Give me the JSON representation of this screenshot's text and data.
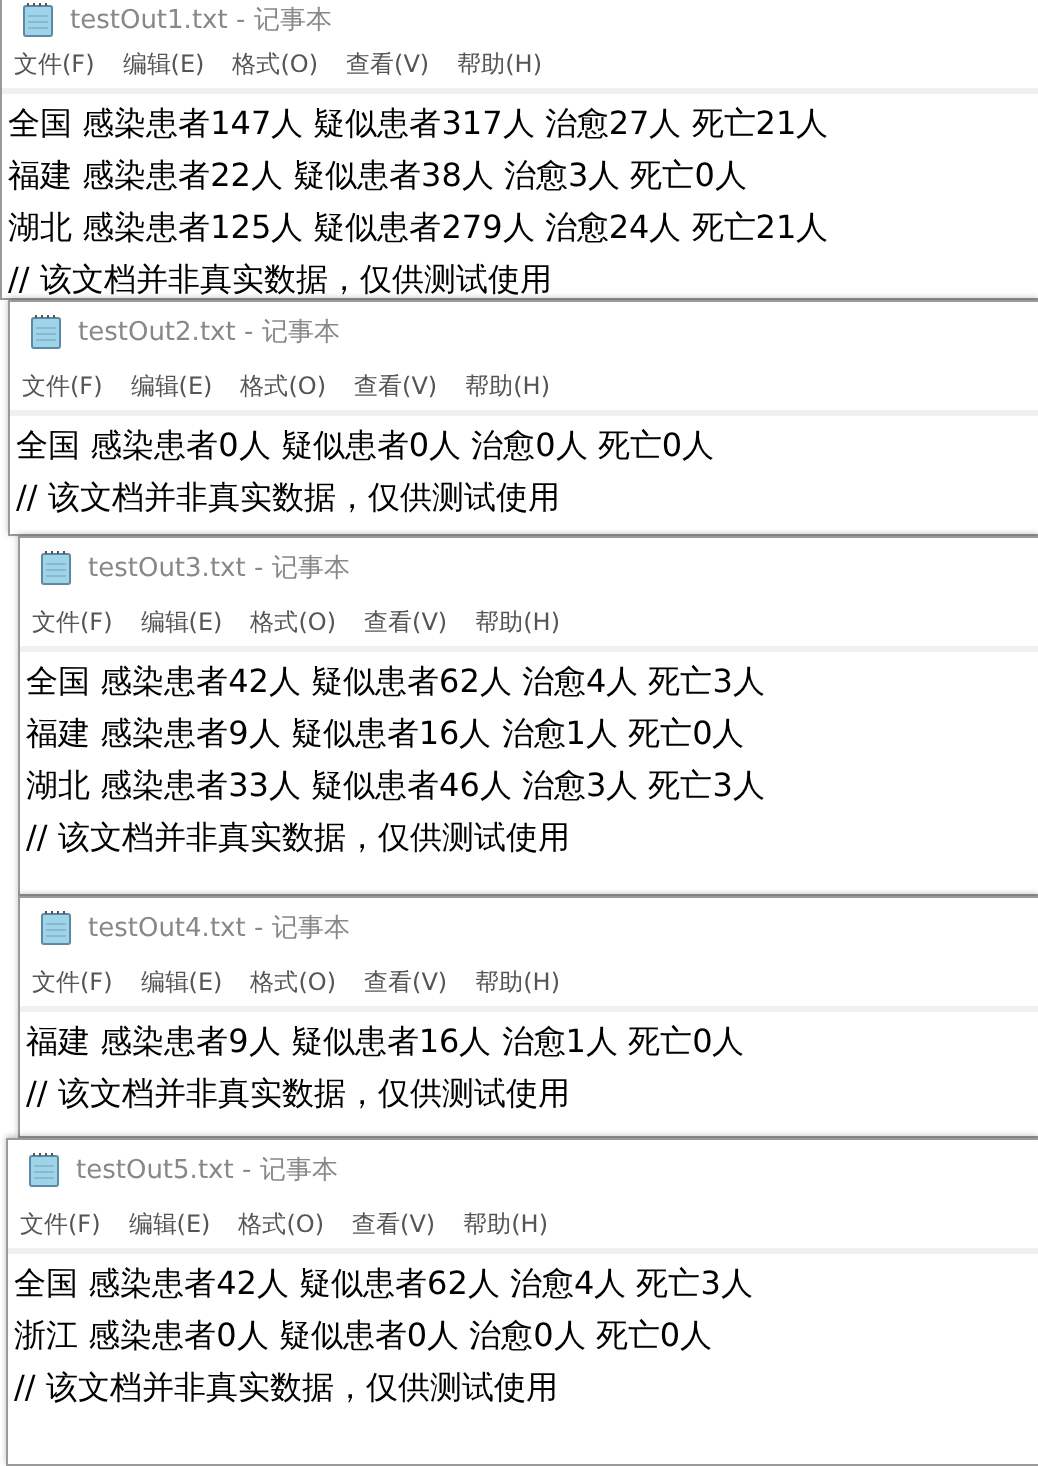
{
  "windows": [
    {
      "title": "testOut1.txt - 记事本",
      "menu": [
        "文件(F)",
        "编辑(E)",
        "格式(O)",
        "查看(V)",
        "帮助(H)"
      ],
      "lines": [
        "全国 感染患者147人 疑似患者317人 治愈27人 死亡21人",
        "福建 感染患者22人 疑似患者38人 治愈3人 死亡0人",
        "湖北 感染患者125人 疑似患者279人 治愈24人 死亡21人",
        "// 该文档并非真实数据，仅供测试使用"
      ]
    },
    {
      "title": "testOut2.txt - 记事本",
      "menu": [
        "文件(F)",
        "编辑(E)",
        "格式(O)",
        "查看(V)",
        "帮助(H)"
      ],
      "lines": [
        "全国 感染患者0人 疑似患者0人 治愈0人 死亡0人",
        "// 该文档并非真实数据，仅供测试使用"
      ]
    },
    {
      "title": "testOut3.txt - 记事本",
      "menu": [
        "文件(F)",
        "编辑(E)",
        "格式(O)",
        "查看(V)",
        "帮助(H)"
      ],
      "lines": [
        "全国 感染患者42人 疑似患者62人 治愈4人 死亡3人",
        "福建 感染患者9人 疑似患者16人 治愈1人 死亡0人",
        "湖北 感染患者33人 疑似患者46人 治愈3人 死亡3人",
        "// 该文档并非真实数据，仅供测试使用"
      ]
    },
    {
      "title": "testOut4.txt - 记事本",
      "menu": [
        "文件(F)",
        "编辑(E)",
        "格式(O)",
        "查看(V)",
        "帮助(H)"
      ],
      "lines": [
        "福建 感染患者9人 疑似患者16人 治愈1人 死亡0人",
        "// 该文档并非真实数据，仅供测试使用"
      ]
    },
    {
      "title": "testOut5.txt - 记事本",
      "menu": [
        "文件(F)",
        "编辑(E)",
        "格式(O)",
        "查看(V)",
        "帮助(H)"
      ],
      "lines": [
        "全国 感染患者42人 疑似患者62人 治愈4人 死亡3人",
        "浙江 感染患者0人 疑似患者0人 治愈0人 死亡0人",
        "// 该文档并非真实数据，仅供测试使用"
      ]
    }
  ]
}
